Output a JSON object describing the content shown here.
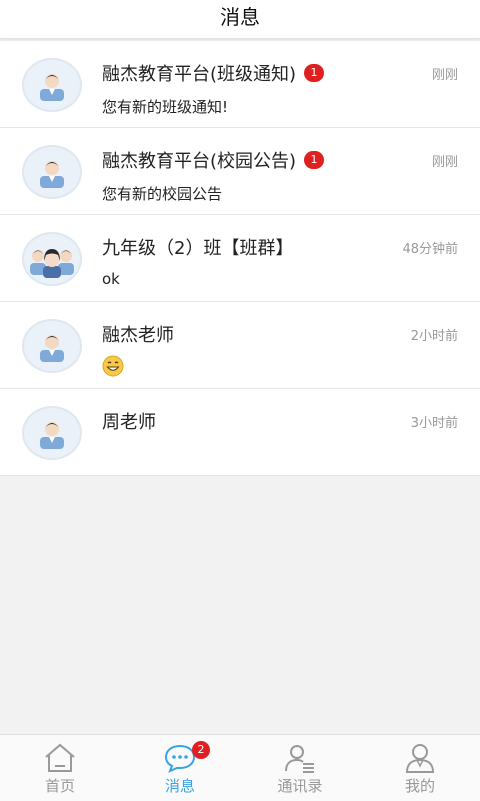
{
  "header": {
    "title": "消息"
  },
  "conversations": [
    {
      "name": "融杰教育平台(班级通知)",
      "badge": "1",
      "time": "刚刚",
      "preview": "您有新的班级通知!",
      "avatar": "person-avatar-icon"
    },
    {
      "name": "融杰教育平台(校园公告)",
      "badge": "1",
      "time": "刚刚",
      "preview": "您有新的校园公告",
      "avatar": "person-avatar-icon"
    },
    {
      "name": "九年级（2）班【班群】",
      "time": "48分钟前",
      "preview": "ok",
      "avatar": "group-avatar-icon"
    },
    {
      "name": "融杰老师",
      "time": "2小时前",
      "preview_emoji": "grinning-face-emoji",
      "avatar": "person-avatar-icon"
    },
    {
      "name": "周老师",
      "time": "3小时前",
      "avatar": "person-avatar-icon"
    }
  ],
  "tabbar": {
    "tabs": [
      {
        "label": "首页",
        "icon": "home-icon"
      },
      {
        "label": "消息",
        "icon": "chat-bubble-icon",
        "badge": "2",
        "active": true
      },
      {
        "label": "通讯录",
        "icon": "contacts-icon"
      },
      {
        "label": "我的",
        "icon": "profile-icon"
      }
    ]
  },
  "colors": {
    "accent": "#3aa3e3",
    "badge": "#e02020"
  }
}
